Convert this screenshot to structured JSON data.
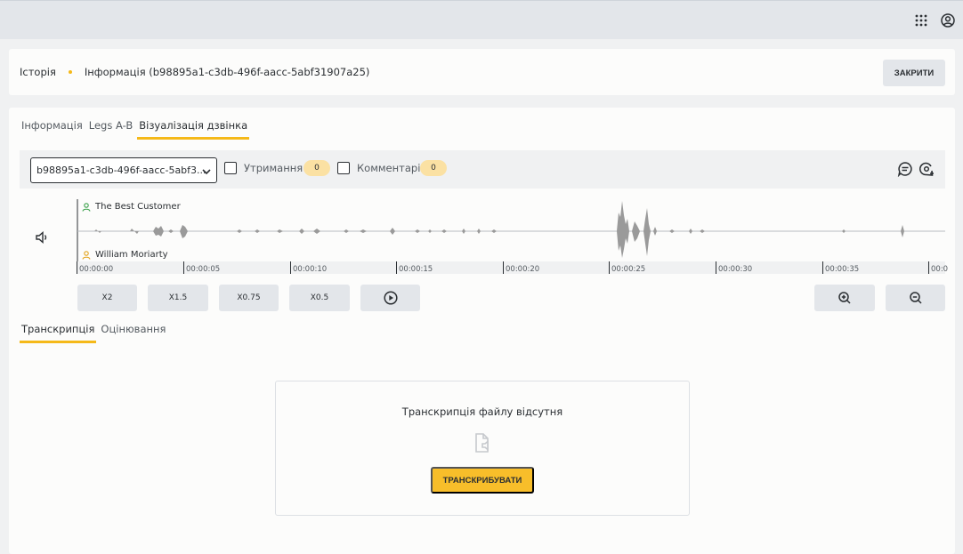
{
  "breadcrumb": {
    "history": "Історія",
    "current": "Інформація (b98895a1-c3db-496f-aacc-5abf31907a25)"
  },
  "close_button": "ЗАКРИТИ",
  "main_tabs": [
    "Інформація",
    "Legs A-B",
    "Візуалізація дзвінка"
  ],
  "toolbar": {
    "select_value": "b98895a1-c3db-496f-aacc-5abf3...",
    "hold_label": "Утримання",
    "hold_count": "0",
    "comments_label": "Комментарі",
    "comments_count": "0"
  },
  "speakers": {
    "customer": "The Best Customer",
    "agent": "William Moriarty"
  },
  "timeline": [
    "00:00:00",
    "00:00:05",
    "00:00:10",
    "00:00:15",
    "00:00:20",
    "00:00:25",
    "00:00:30",
    "00:00:35",
    "00:0"
  ],
  "speed_buttons": [
    "X2",
    "X1.5",
    "X0.75",
    "X0.5"
  ],
  "sub_tabs": [
    "Транскрипція",
    "Оцінювання"
  ],
  "empty_state": {
    "message": "Транскрипція файлу відсутня",
    "button": "ТРАНСКРИБУВАТИ"
  },
  "icons": {
    "apps": "grid-icon",
    "account": "user-circle-icon",
    "volume": "volume-icon",
    "comment": "comment-icon",
    "add_comment": "add-comment-icon",
    "play": "play-icon",
    "zoom_in": "zoom-in-icon",
    "zoom_out": "zoom-out-icon",
    "file": "file-audio-icon"
  },
  "colors": {
    "accent": "#f5b919",
    "badge": "#fbe1a3",
    "customer": "#3aa04a",
    "agent": "#e3a31a"
  }
}
